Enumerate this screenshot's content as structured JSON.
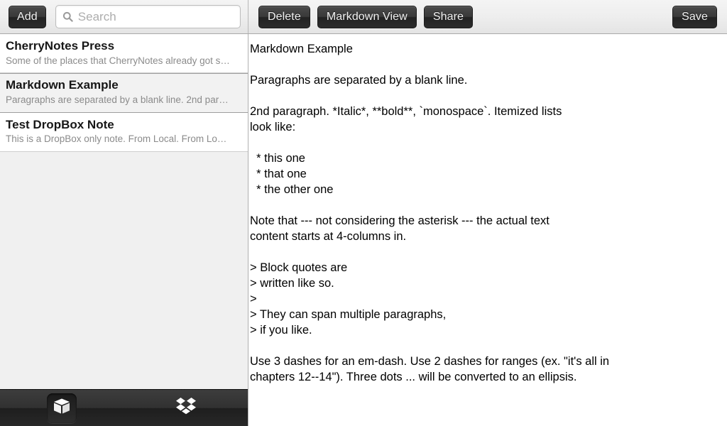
{
  "toolbar": {
    "add_label": "Add",
    "search_placeholder": "Search",
    "search_value": "",
    "search_icon": "search-icon",
    "delete_label": "Delete",
    "markdown_view_label": "Markdown View",
    "share_label": "Share",
    "save_label": "Save"
  },
  "sidebar": {
    "notes": [
      {
        "title": "CherryNotes Press",
        "preview": "Some of the places that CherryNotes already got s…",
        "selected": false
      },
      {
        "title": "Markdown Example",
        "preview": "Paragraphs are separated by a blank line. 2nd par…",
        "selected": true
      },
      {
        "title": "Test DropBox Note",
        "preview": "This is a DropBox only note. From Local. From Lo…",
        "selected": false
      }
    ],
    "tabs": [
      {
        "name": "local-notes-tab",
        "icon": "box-icon",
        "active": true
      },
      {
        "name": "dropbox-tab",
        "icon": "dropbox-icon",
        "active": false
      }
    ]
  },
  "editor": {
    "content": "Markdown Example\n\nParagraphs are separated by a blank line.\n\n2nd paragraph. *Italic*, **bold**, `monospace`. Itemized lists\nlook like:\n\n  * this one\n  * that one\n  * the other one\n\nNote that --- not considering the asterisk --- the actual text\ncontent starts at 4-columns in.\n\n> Block quotes are\n> written like so.\n>\n> They can span multiple paragraphs,\n> if you like.\n\nUse 3 dashes for an em-dash. Use 2 dashes for ranges (ex. \"it's all in\nchapters 12--14\"). Three dots ... will be converted to an ellipsis."
  },
  "colors": {
    "toolbar_bg": "#eeeeee",
    "button_dark": "#2c2c2c",
    "sidebar_bg": "#f0f0f0",
    "selected_row_bg": "#f2f2f2",
    "preview_text": "#8b8b8b",
    "tabbar_bg": "#282828",
    "editor_bg": "#ffffff"
  }
}
